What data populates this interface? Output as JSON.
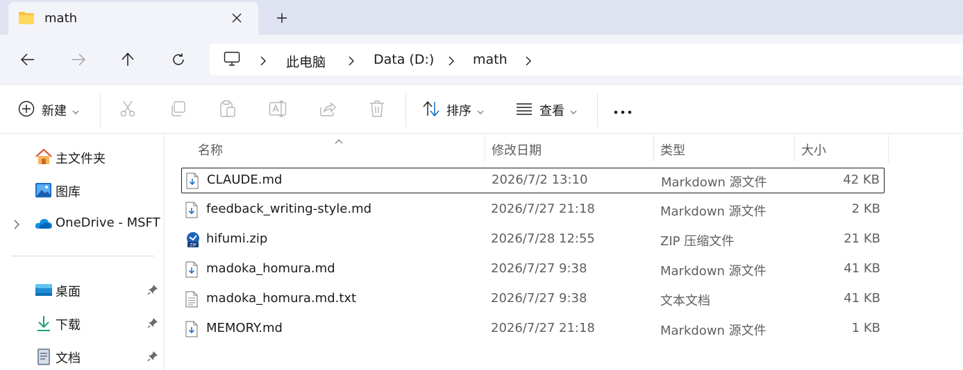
{
  "tab": {
    "title": "math",
    "icon": "folder-icon",
    "close_icon": "close-icon",
    "new_tab_icon": "plus-icon"
  },
  "nav": {
    "back_icon": "arrow-left-icon",
    "forward_icon": "arrow-right-icon",
    "up_icon": "arrow-up-icon",
    "refresh_icon": "refresh-icon",
    "breadcrumbs": [
      "此电脑",
      "Data (D:)",
      "math"
    ]
  },
  "toolbar": {
    "new_label": "新建",
    "sort_label": "排序",
    "view_label": "查看",
    "icons": [
      "cut-icon",
      "copy-icon",
      "paste-icon",
      "rename-icon",
      "share-icon",
      "delete-icon",
      "more-icon"
    ]
  },
  "sidebar": {
    "items": [
      {
        "label": "主文件夹",
        "icon": "home-icon"
      },
      {
        "label": "图库",
        "icon": "gallery-icon"
      },
      {
        "label": "OneDrive - MSFT",
        "icon": "cloud-icon"
      }
    ],
    "pinned": [
      {
        "label": "桌面",
        "icon": "desktop-icon"
      },
      {
        "label": "下载",
        "icon": "download-icon"
      },
      {
        "label": "文档",
        "icon": "document-icon"
      }
    ]
  },
  "columns": {
    "name": "名称",
    "date": "修改日期",
    "type": "类型",
    "size": "大小"
  },
  "files": [
    {
      "name": "CLAUDE.md",
      "date": "2026/7/2 13:10",
      "type": "Markdown 源文件",
      "size": "42 KB",
      "icon": "markdown-file-icon"
    },
    {
      "name": "feedback_writing-style.md",
      "date": "2026/7/27 21:18",
      "type": "Markdown 源文件",
      "size": "2 KB",
      "icon": "markdown-file-icon"
    },
    {
      "name": "hifumi.zip",
      "date": "2026/7/28 12:55",
      "type": "ZIP 压缩文件",
      "size": "21 KB",
      "icon": "zip-file-icon"
    },
    {
      "name": "madoka_homura.md",
      "date": "2026/7/27 9:38",
      "type": "Markdown 源文件",
      "size": "41 KB",
      "icon": "markdown-file-icon"
    },
    {
      "name": "madoka_homura.md.txt",
      "date": "2026/7/27 9:38",
      "type": "文本文档",
      "size": "41 KB",
      "icon": "text-file-icon"
    },
    {
      "name": "MEMORY.md",
      "date": "2026/7/27 21:18",
      "type": "Markdown 源文件",
      "size": "1 KB",
      "icon": "markdown-file-icon"
    }
  ],
  "selected_file": "CLAUDE.md",
  "colors": {
    "accent": "#0067c0",
    "tab_strip": "#dfe3f1",
    "nav_bg": "#f3f4f9"
  }
}
